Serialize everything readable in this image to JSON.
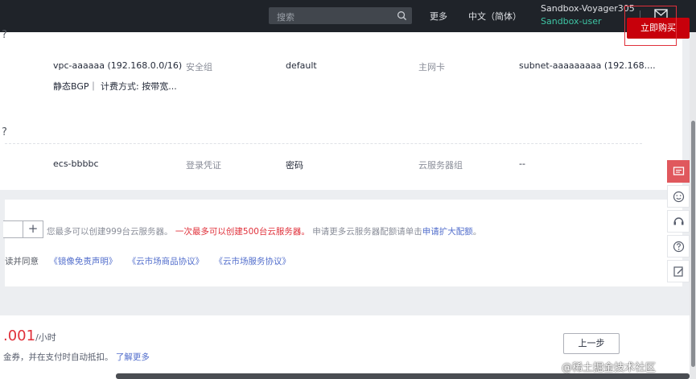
{
  "header": {
    "search_placeholder": "搜索",
    "more_label": "更多",
    "language_label": "中文（简体）",
    "user_name": "Sandbox-Voyager305",
    "user_sub": "Sandbox-user"
  },
  "network_row": {
    "vpc": "vpc-aaaaaa (192.168.0.0/16)",
    "sg_label": "安全组",
    "sg_value": "default",
    "nic_label": "主网卡",
    "subnet_value": "subnet-aaaaaaaaa (192.168....",
    "bandwidth_desc": "静态BGP｜ 计费方式: 按带宽..."
  },
  "advanced_row": {
    "ecs_name": "ecs-bbbbc",
    "login_label": "登录凭证",
    "login_value": "密码",
    "group_label": "云服务器组",
    "group_value": "--"
  },
  "quantity": {
    "plus_label": "+",
    "quota_text_1": "您最多可以创建999台云服务器。",
    "quota_text_red": "一次最多可以创建500台云服务器。",
    "quota_text_2": "申请更多云服务器配额请单击",
    "quota_link": "申请扩大配额",
    "quota_end": "。"
  },
  "agreement": {
    "prefix": "读并同意",
    "link1": "《镜像免责声明》",
    "link2": "《云市场商品协议》",
    "link3": "《云市场服务协议》"
  },
  "footer": {
    "price": ".001",
    "price_unit": "/小时",
    "coupon_text": "金券，并在支付时自动抵扣。",
    "coupon_link": "了解更多",
    "prev_label": "上一步",
    "buy_label": "立即购买",
    "watermark": "@稀土掘金技术社区"
  },
  "edge_marks": [
    "?",
    "?"
  ],
  "icons": [
    "search-icon",
    "mail-icon",
    "feedback-icon",
    "smile-icon",
    "service-icon",
    "help-icon",
    "edit-icon"
  ],
  "colors": {
    "topbar": "#1f2329",
    "accent_red": "#c7000b",
    "link_blue": "#526ecc",
    "user_green": "#3ec5a4",
    "warning_red": "#e0303a"
  }
}
